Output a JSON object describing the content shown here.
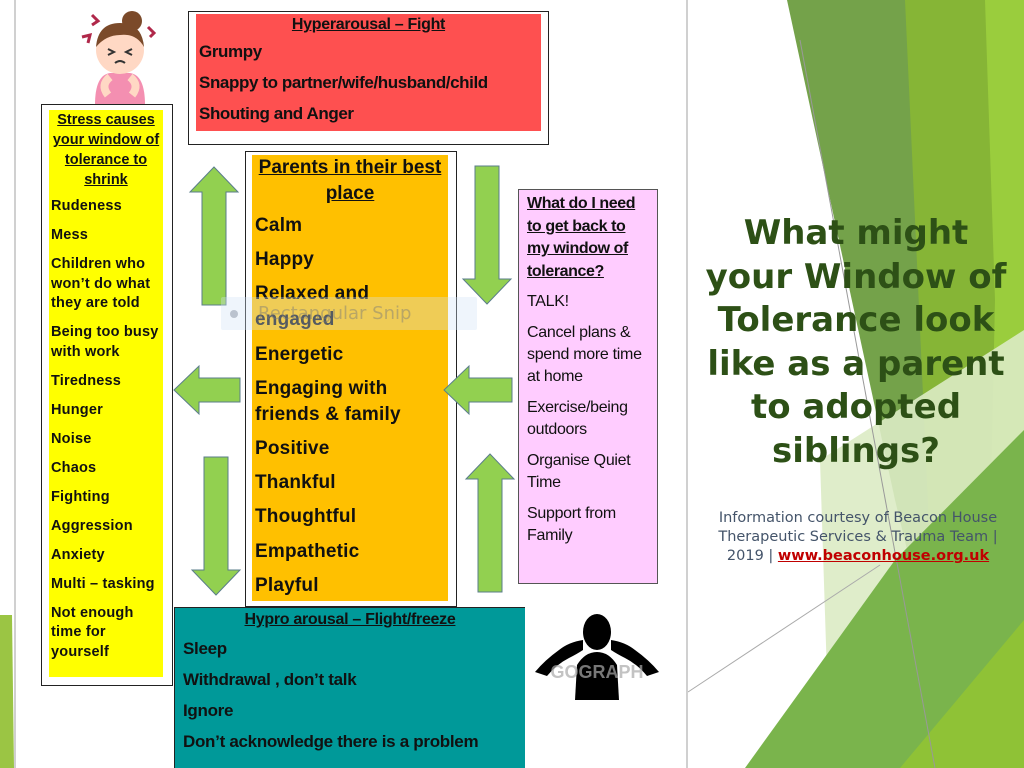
{
  "hyperarousal": {
    "title": "Hyperarousal – Fight",
    "items": [
      "Grumpy",
      "Snappy to partner/wife/husband/child",
      "Shouting and Anger"
    ]
  },
  "stress": {
    "title": "Stress causes your window of tolerance to shrink",
    "items": [
      "Rudeness",
      "Mess",
      "Children who won’t do what they are told",
      "Being too busy with work",
      "Tiredness",
      "Hunger",
      "Noise",
      "Chaos",
      "Fighting",
      "Aggression",
      "Anxiety",
      "Multi – tasking",
      "Not enough time for yourself"
    ]
  },
  "best_place": {
    "title": "Parents in their best place",
    "items": [
      "Calm",
      "Happy",
      "Relaxed and engaged",
      "Energetic",
      "Engaging with friends & family",
      "Positive",
      "Thankful",
      "Thoughtful",
      "Empathetic",
      "Playful"
    ]
  },
  "need": {
    "title": "What do I need to get back to my window of tolerance?",
    "items": [
      "TALK!",
      "Cancel plans & spend more time at home",
      "Exercise/being outdoors",
      "Organise Quiet Time",
      "Support from Family"
    ]
  },
  "hypoarousal": {
    "title": "Hypro arousal – Flight/freeze",
    "items": [
      "Sleep",
      "Withdrawal , don’t talk",
      "Ignore",
      "Don’t acknowledge there is a problem"
    ]
  },
  "overlay": {
    "snip_label": "Rectangular Snip",
    "watermark": "GOGRAPH"
  },
  "headline": "What might your Window of Tolerance look like as a parent to adopted siblings?",
  "credit": {
    "text": "Information courtesy of Beacon House Therapeutic Services & Trauma Team | 2019 | ",
    "link": "www.beaconhouse.org.uk"
  },
  "colors": {
    "hyper": "#fe5050",
    "stress": "#ffff00",
    "best": "#ffc000",
    "need": "#ffccff",
    "hypo": "#009999",
    "arrow": "#92d050",
    "headline": "#2d5016",
    "link": "#c00000"
  }
}
